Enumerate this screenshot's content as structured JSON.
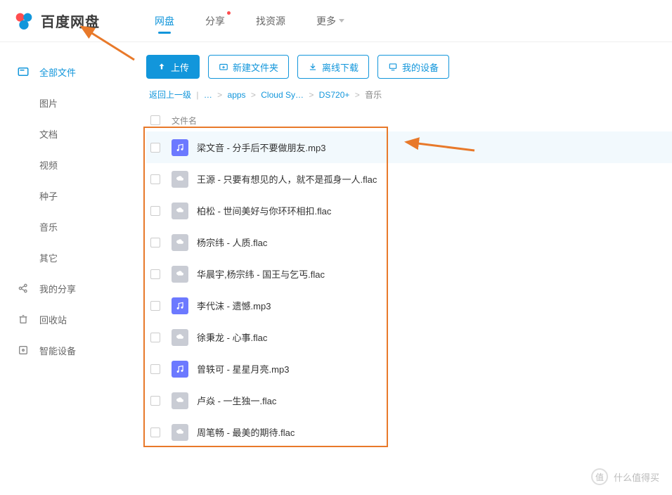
{
  "header": {
    "brand": "百度网盘",
    "nav": [
      {
        "label": "网盘",
        "active": true
      },
      {
        "label": "分享",
        "dot": true
      },
      {
        "label": "找资源"
      },
      {
        "label": "更多",
        "more": true
      }
    ]
  },
  "sidebar": {
    "all_files": "全部文件",
    "subs": [
      "图片",
      "文档",
      "视频",
      "种子",
      "音乐",
      "其它"
    ],
    "my_share": "我的分享",
    "recycle": "回收站",
    "devices": "智能设备"
  },
  "toolbar": {
    "upload": "上传",
    "new_folder": "新建文件夹",
    "offline_dl": "离线下载",
    "my_devices": "我的设备"
  },
  "breadcrumb": {
    "back": "返回上一级",
    "parts": [
      "…",
      "apps",
      "Cloud Sy…",
      "DS720+",
      "音乐"
    ],
    "sep": ">"
  },
  "list": {
    "header_name": "文件名",
    "files": [
      {
        "name": "梁文音 - 分手后不要做朋友.mp3",
        "type": "mp3",
        "hover": true
      },
      {
        "name": "王源 - 只要有想见的人，就不是孤身一人.flac",
        "type": "flac"
      },
      {
        "name": "柏松 - 世间美好与你环环相扣.flac",
        "type": "flac"
      },
      {
        "name": "杨宗纬 - 人质.flac",
        "type": "flac"
      },
      {
        "name": "华晨宇,杨宗纬 - 国王与乞丐.flac",
        "type": "flac"
      },
      {
        "name": "李代沫 - 遗憾.mp3",
        "type": "mp3"
      },
      {
        "name": "徐秉龙 - 心事.flac",
        "type": "flac"
      },
      {
        "name": "曾轶可 - 星星月亮.mp3",
        "type": "mp3"
      },
      {
        "name": "卢焱 - 一生独一.flac",
        "type": "flac"
      },
      {
        "name": "周笔畅 - 最美的期待.flac",
        "type": "flac"
      }
    ]
  },
  "watermark": "什么值得买"
}
